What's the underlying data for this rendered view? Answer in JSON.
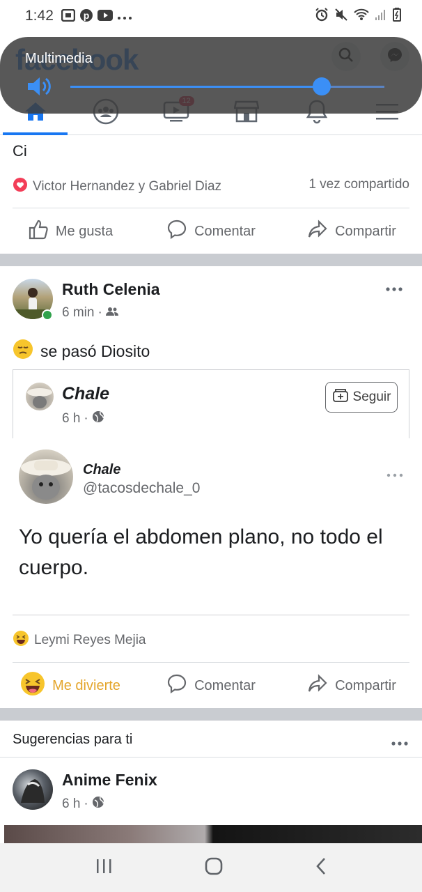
{
  "status_bar": {
    "time": "1:42",
    "left_icons": [
      "gallery-icon",
      "pinterest-icon",
      "youtube-icon",
      "more-icon"
    ],
    "right_icons": [
      "alarm-icon",
      "mute-icon",
      "wifi-icon",
      "signal-icon",
      "battery-icon"
    ]
  },
  "header": {
    "logo": "facebook",
    "tabs": [
      {
        "name": "home",
        "active": true
      },
      {
        "name": "groups",
        "active": false
      },
      {
        "name": "watch",
        "active": false,
        "badge": "12"
      },
      {
        "name": "marketplace",
        "active": false
      },
      {
        "name": "notifications",
        "active": false
      },
      {
        "name": "menu",
        "active": false
      }
    ]
  },
  "volume": {
    "label": "Multimedia",
    "level": 0.8
  },
  "previous_post": {
    "text": "Ci",
    "reactors": "Victor Hernandez y Gabriel Diaz",
    "shares": "1 vez compartido",
    "actions": {
      "like": "Me gusta",
      "comment": "Comentar",
      "share": "Compartir"
    }
  },
  "post": {
    "author": "Ruth Celenia",
    "time": "6 min",
    "text": "se pasó Diosito",
    "shared": {
      "page_name": "Chale",
      "time": "6 h",
      "follow_label": "Seguir",
      "tweet": {
        "name": "Chale",
        "handle": "@tacosdechale_0",
        "text": "Yo quería el abdomen plano, no todo el cuerpo."
      }
    },
    "reactors": "Leymi Reyes Mejia",
    "actions": {
      "reaction": "Me divierte",
      "comment": "Comentar",
      "share": "Compartir"
    },
    "colors": {
      "reaction": "#e4a52b"
    }
  },
  "suggestions": {
    "title": "Sugerencias para ti",
    "page_name": "Anime Fenix",
    "time": "6 h"
  },
  "colors": {
    "brand": "#1877f2",
    "secondary_text": "#65676b",
    "separator": "#c9ccd1"
  }
}
